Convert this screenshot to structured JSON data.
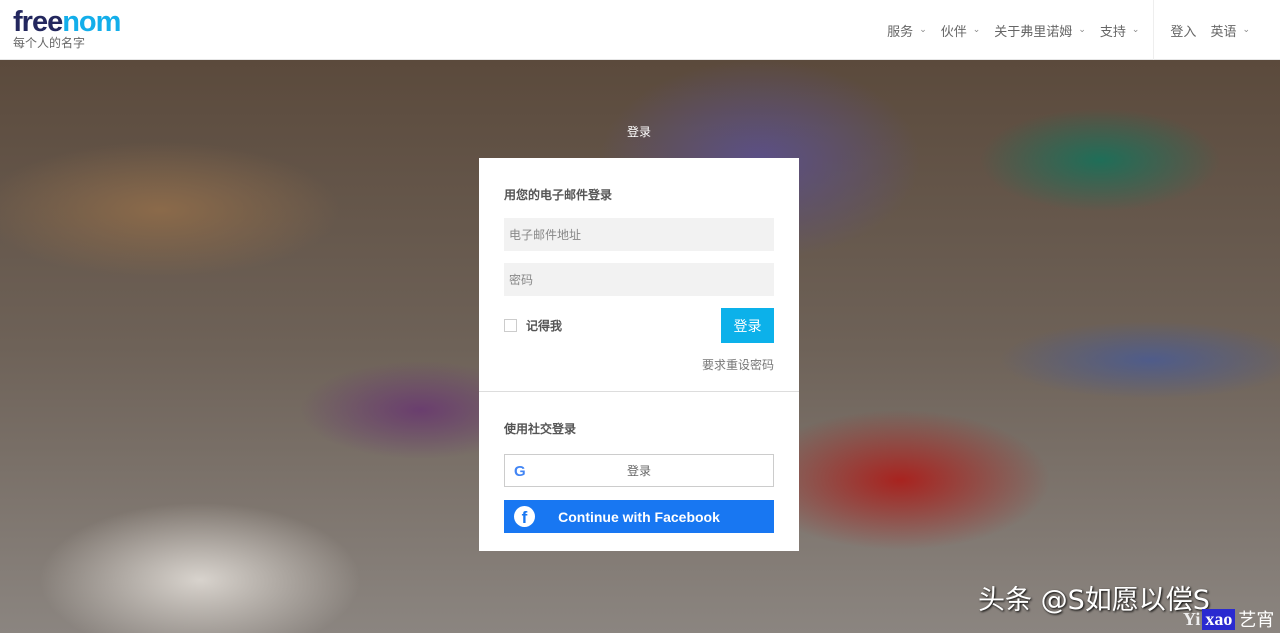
{
  "header": {
    "logo_text_dark": "free",
    "logo_text_blue": "nom",
    "logo_tagline": "每个人的名字",
    "nav": [
      {
        "label": "服务"
      },
      {
        "label": "伙伴"
      },
      {
        "label": "关于弗里诺姆"
      },
      {
        "label": "支持"
      }
    ],
    "login": "登入",
    "language": "英语"
  },
  "page": {
    "top_label": "登录"
  },
  "card": {
    "email_heading": "用您的电子邮件登录",
    "email_placeholder": "电子邮件地址",
    "password_placeholder": "密码",
    "remember_me": "记得我",
    "login_button": "登录",
    "forgot_password": "要求重设密码",
    "social_heading": "使用社交登录",
    "google_button": "登录",
    "facebook_button": "Continue with Facebook"
  },
  "watermark": {
    "line1": "头条 @S如愿以偿S",
    "brand_yi": "Yi",
    "brand_xao": "xao",
    "brand_cn": "艺宵"
  },
  "colors": {
    "accent": "#0cb1ea",
    "facebook": "#1877f2",
    "logo_dark": "#23275e"
  }
}
